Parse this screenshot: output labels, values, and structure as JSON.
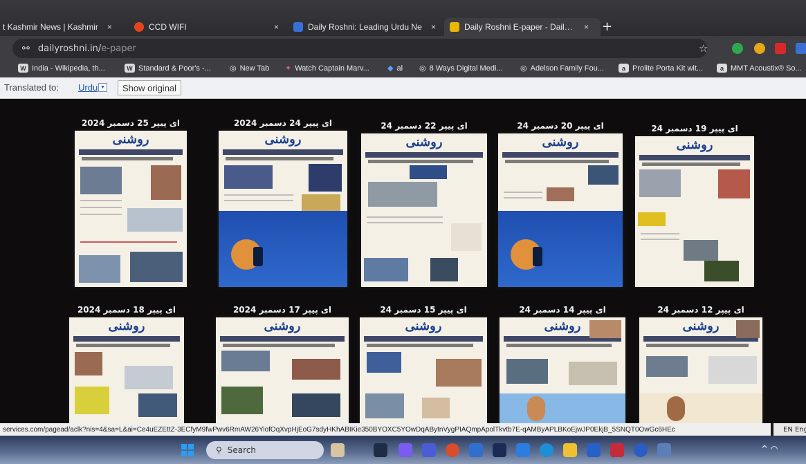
{
  "browser": {
    "tabs": [
      {
        "title": "t Kashmir News | Kashmir",
        "close": "×",
        "favicon_color": "#d33"
      },
      {
        "title": "CCD WIFI",
        "close": "×",
        "favicon_color": "#e2451d"
      },
      {
        "title": "Daily Roshni: Leading Urdu Ne",
        "close": "×",
        "favicon_color": "#3a6fd8"
      },
      {
        "title": "Daily Roshni E-paper - Daily Ro",
        "close": "×",
        "favicon_color": "#e8b800"
      }
    ],
    "new_tab": "+",
    "address": {
      "host": "dailyroshni.in/",
      "path": "e-paper",
      "site_icon": "⚯"
    },
    "star": "☆",
    "bookmarks": [
      {
        "label": "India - Wikipedia, th...",
        "icon": "W"
      },
      {
        "label": "Standard & Poor's -...",
        "icon": "W"
      },
      {
        "label": "New Tab",
        "icon": "◎"
      },
      {
        "label": "Watch Captain Marv...",
        "icon": "✦"
      },
      {
        "label": "al",
        "icon": "◆"
      },
      {
        "label": "8 Ways Digital Medi...",
        "icon": "◎"
      },
      {
        "label": "Adelson Family Fou...",
        "icon": "◎"
      },
      {
        "label": "Prolite Porta Kit wit...",
        "icon": "a"
      },
      {
        "label": "MMT Acoustix® So...",
        "icon": "a"
      }
    ]
  },
  "translate_bar": {
    "prefix": "Translated to:",
    "language": "Urdu",
    "dropdown": "▼",
    "show_original": "Show original"
  },
  "epapers": [
    {
      "date": "ای پیپر 25 دسمبر 2024",
      "masthead": "روشنی",
      "ad": false
    },
    {
      "date": "ای پیپر 24 دسمبر 2024",
      "masthead": "روشنی",
      "ad": true
    },
    {
      "date": "ای پیپر 22 دسمبر 24",
      "masthead": "روشنی",
      "ad": false
    },
    {
      "date": "ای پیپر 20 دسمبر 24",
      "masthead": "روشنی",
      "ad": true
    },
    {
      "date": "ای پیپر 19 دسمبر 24",
      "masthead": "روشنی",
      "ad": false
    },
    {
      "date": "ای پیپر 18 دسمبر 2024",
      "masthead": "روشنی",
      "ad": false
    },
    {
      "date": "ای پیپر 17 دسمبر 2024",
      "masthead": "روشنی",
      "ad": false
    },
    {
      "date": "ای پیپر 15 دسمبر 24",
      "masthead": "روشنی",
      "ad": false
    },
    {
      "date": "ای پیپر 14 دسمبر 24",
      "masthead": "روشنی",
      "ad": false
    },
    {
      "date": "ای پیپر 12 دسمبر 24",
      "masthead": "روشنی",
      "ad": false
    }
  ],
  "status_url": "services.com/pagead/aclk?nis=4&sa=L&ai=Ce4uEZEttZ-3ECfyM9fwPwv6RmAW26YiofOqXvpHjEoG7sdyHKhABIKie350BYOXC5YOwDqABytnVygPIAQmpApolTkvtb7E-qAMByAPLBKoEjwJP0EkjB_5SNQT0OwGc6HEc",
  "taskbar": {
    "search": "Search",
    "search_icon": "⚲",
    "language_indicator": "EN Eng",
    "tray": "^ ◠"
  }
}
